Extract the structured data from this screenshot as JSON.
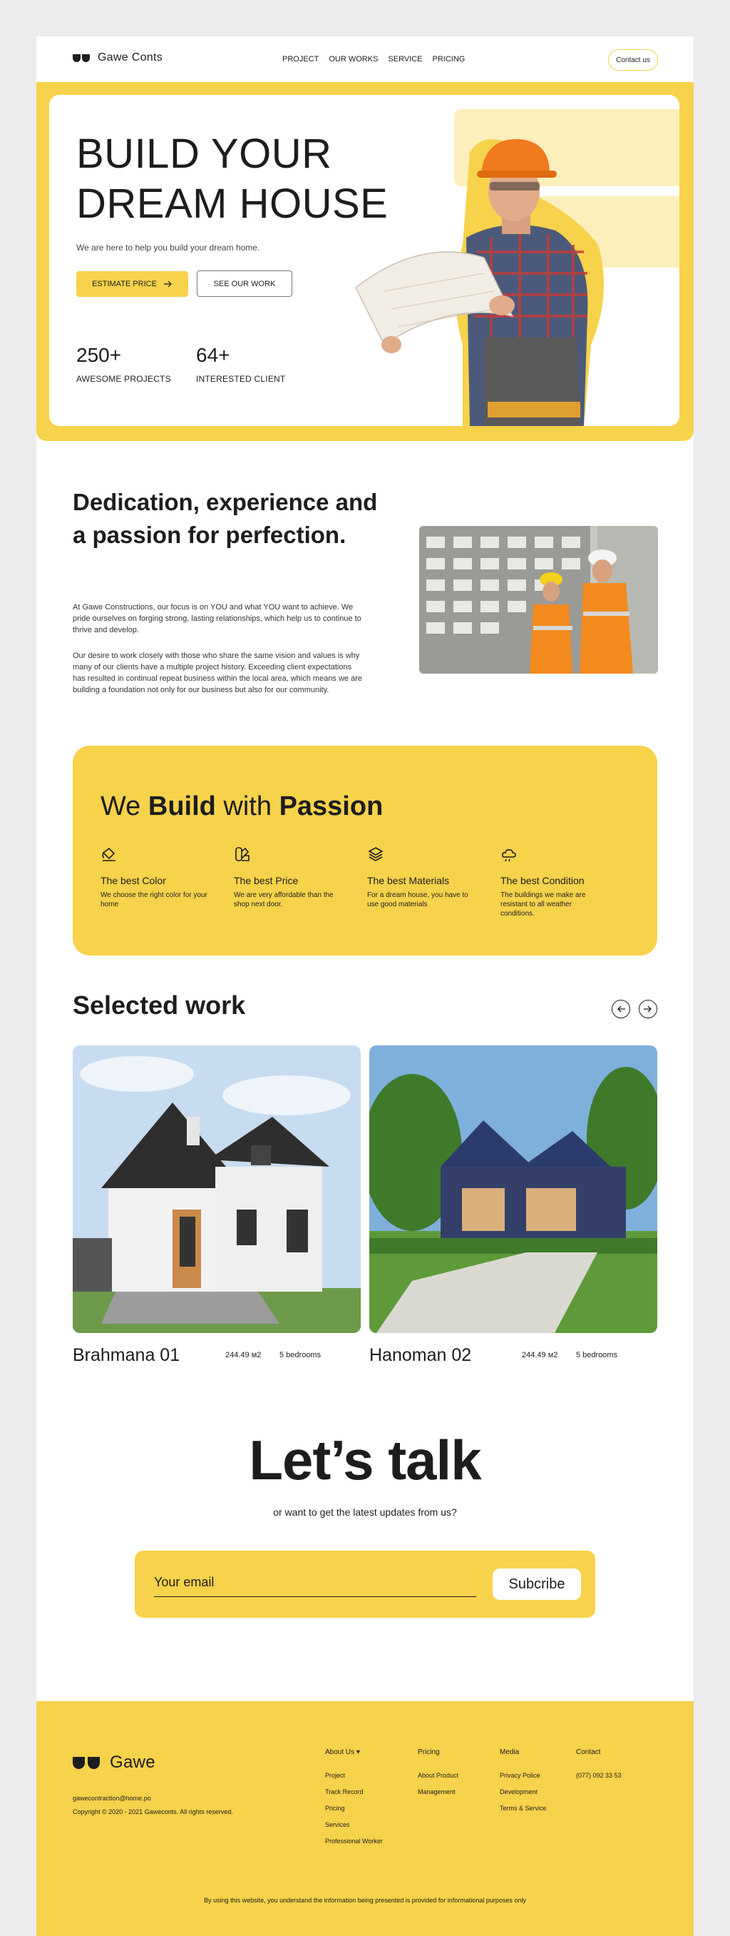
{
  "brand": {
    "name": "Gawe Conts",
    "footer_name": "Gawe"
  },
  "nav": {
    "links": [
      "PROJECT",
      "OUR WORKS",
      "SERVICE",
      "PRICING"
    ],
    "contact": "Contact us"
  },
  "hero": {
    "title_line1": "BUILD YOUR",
    "title_line2": "DREAM HOUSE",
    "subtitle": "We are here to help you build your dream home.",
    "cta_primary": "ESTIMATE PRICE",
    "cta_secondary": "SEE OUR WORK",
    "stats": [
      {
        "value": "250+",
        "label": "AWESOME PROJECTS"
      },
      {
        "value": "64+",
        "label": "INTERESTED CLIENT"
      }
    ]
  },
  "dedication": {
    "title": "Dedication, experience and a passion for perfection.",
    "p1": "At Gawe Constructions, our focus is on YOU and what YOU want to achieve. We pride ourselves on forging strong, lasting relationships, which help us to continue to thrive and develop.",
    "p2": "Our desire to work closely with those who share the same vision and values is why many of our clients have a multiple project history. Exceeding client expectations has resulted in continual repeat business within the local area, which means we are building a foundation not only for our business but also for our community."
  },
  "passion": {
    "title_a": "We ",
    "title_b": "Build",
    "title_c": " with ",
    "title_d": "Passion",
    "features": [
      {
        "icon": "paint-bucket-icon",
        "name": "The best Color",
        "desc": "We choose the right color for your home"
      },
      {
        "icon": "swatch-icon",
        "name": "The best Price",
        "desc": "We are very affordable than the shop next door."
      },
      {
        "icon": "layers-icon",
        "name": "The best Materials",
        "desc": "For a dream house, you have to use good materials"
      },
      {
        "icon": "cloud-weather-icon",
        "name": "The best Condition",
        "desc": "The buildings we make are resistant to all weather conditions."
      }
    ]
  },
  "works": {
    "title": "Selected work",
    "items": [
      {
        "name": "Brahmana 01",
        "area": "244.49 м2",
        "bedrooms": "5 bedrooms"
      },
      {
        "name": "Hanoman 02",
        "area": "244.49 м2",
        "bedrooms": "5 bedrooms"
      }
    ]
  },
  "talk": {
    "title": "Let’s talk",
    "subtitle": "or want to get the latest updates from us?",
    "placeholder": "Your email",
    "button": "Subcribe"
  },
  "footer": {
    "email": "gawecontraction@home.po",
    "copyright": "Copyright © 2020 - 2021 Gaweconts. All rights reserved.",
    "columns": [
      {
        "head": "About Us",
        "items": [
          "Project",
          "Track Record",
          "Pricing",
          "Services",
          "Professional Worker"
        ]
      },
      {
        "head": "Pricing",
        "items": [
          "About Product",
          "Management"
        ]
      },
      {
        "head": "Media",
        "items": [
          "Privacy Police",
          "Development",
          "Terms & Service"
        ]
      },
      {
        "head": "Contact",
        "items": [
          "(077) 092 33 53"
        ]
      }
    ],
    "disclaimer": "By using this website, you understand the information being presented is provided for informational purposes only"
  },
  "colors": {
    "accent": "#f7d24b",
    "accent_light": "#fcefbc",
    "text": "#1d1d1d"
  }
}
